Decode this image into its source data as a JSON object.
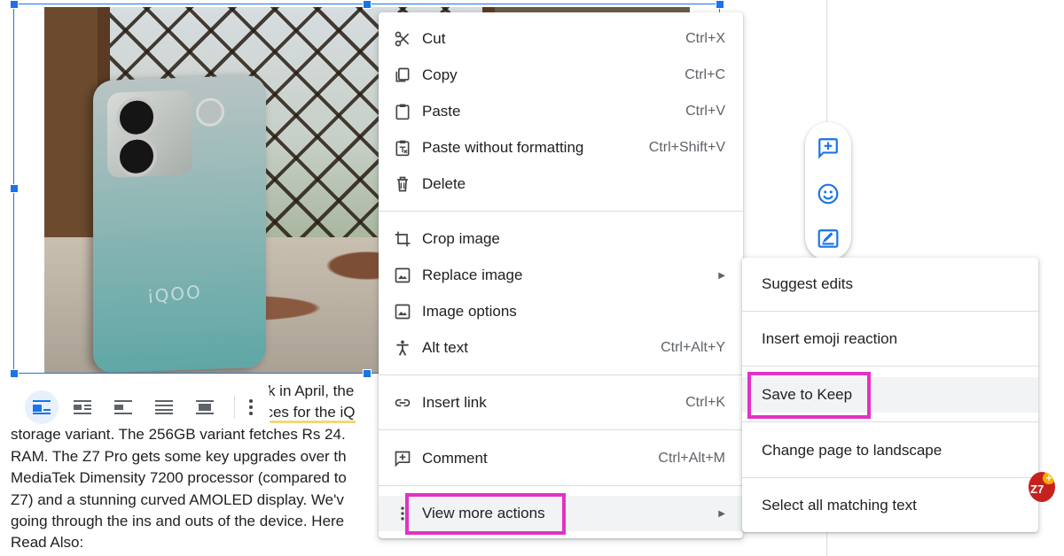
{
  "document": {
    "text_lines": [
      " ",
      "",
      "storage variant. The 256GB variant fetches Rs 24.",
      "RAM. The Z7 Pro gets some key upgrades over th",
      "MediaTek Dimensity 7200 processor (compared to",
      "Z7) and a stunning curved AMOLED display. We'v",
      "going through the ins and outs of the device. Here",
      "Read Also:"
    ],
    "partial_line_1": "nck in April, the",
    "partial_line_2": "rices for the iQ",
    "image_brand_text": "iQOO"
  },
  "image_toolbar": {
    "buttons": [
      "inline",
      "wrap-text",
      "break-text",
      "behind-text",
      "in-front-of-text"
    ],
    "active": "inline"
  },
  "context_menu": {
    "items": [
      {
        "label": "Cut",
        "shortcut": "Ctrl+X",
        "icon": "scissors-icon"
      },
      {
        "label": "Copy",
        "shortcut": "Ctrl+C",
        "icon": "copy-icon"
      },
      {
        "label": "Paste",
        "shortcut": "Ctrl+V",
        "icon": "clipboard-icon"
      },
      {
        "label": "Paste without formatting",
        "shortcut": "Ctrl+Shift+V",
        "icon": "clipboard-text-icon"
      },
      {
        "label": "Delete",
        "shortcut": "",
        "icon": "trash-icon"
      },
      {
        "label": "Crop image",
        "shortcut": "",
        "icon": "crop-icon"
      },
      {
        "label": "Replace image",
        "shortcut": "",
        "icon": "image-icon",
        "submenu": true
      },
      {
        "label": "Image options",
        "shortcut": "",
        "icon": "image-icon"
      },
      {
        "label": "Alt text",
        "shortcut": "Ctrl+Alt+Y",
        "icon": "accessibility-icon"
      },
      {
        "label": "Insert link",
        "shortcut": "Ctrl+K",
        "icon": "link-icon"
      },
      {
        "label": "Comment",
        "shortcut": "Ctrl+Alt+M",
        "icon": "add-comment-icon"
      },
      {
        "label": "View more actions",
        "shortcut": "",
        "icon": "more-vert-icon",
        "submenu": true
      }
    ]
  },
  "submenu": {
    "items": [
      {
        "label": "Suggest edits"
      },
      {
        "label": "Insert emoji reaction"
      },
      {
        "label": "Save to Keep"
      },
      {
        "label": "Change page to landscape"
      },
      {
        "label": "Select all matching text"
      }
    ]
  },
  "badge": {
    "text": "Z7",
    "plus": "+"
  },
  "colors": {
    "accent": "#1a73e8",
    "highlight_box": "#e232c4",
    "menu_hover": "#f1f3f4"
  }
}
